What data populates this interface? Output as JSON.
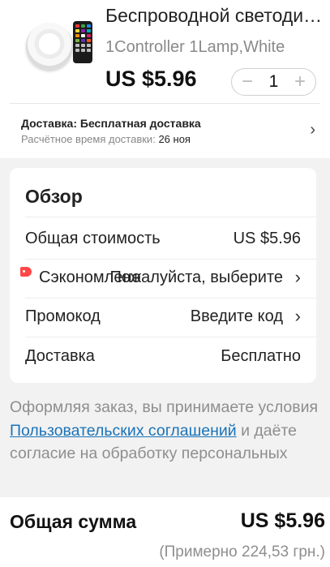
{
  "product": {
    "title": "Беспроводной светодиодный светильник",
    "variant": "1Controller 1Lamp,White",
    "price": "US $5.96",
    "quantity": "1",
    "minus": "−",
    "plus": "+"
  },
  "delivery": {
    "title": "Доставка: Бесплатная доставка",
    "estimate_label": "Расчётное время доставки:",
    "estimate_date": "26 ноя"
  },
  "overview": {
    "title": "Обзор",
    "total_cost_label": "Общая стоимость",
    "total_cost_value": "US $5.96",
    "saved_label": "Сэкономлено",
    "saved_value": "Пожалуйста, выберите",
    "promo_label": "Промокод",
    "promo_value": "Введите код",
    "shipping_label": "Доставка",
    "shipping_value": "Бесплатно"
  },
  "legal": {
    "text_before": "Оформляя заказ, вы принимаете условия ",
    "link": "Пользовательских соглашений",
    "text_after": " и даёте согласие на обработку персональных"
  },
  "footer": {
    "total_label": "Общая сумма",
    "total_value": "US $5.96",
    "approx": "(Примерно 224,53 грн.)"
  },
  "icons": [
    "chevron-right-icon",
    "coupon-tag-icon",
    "minus-icon",
    "plus-icon"
  ],
  "colors": {
    "link": "#1a73b8",
    "tag": "#ff4747",
    "muted": "#8e8e8e"
  }
}
